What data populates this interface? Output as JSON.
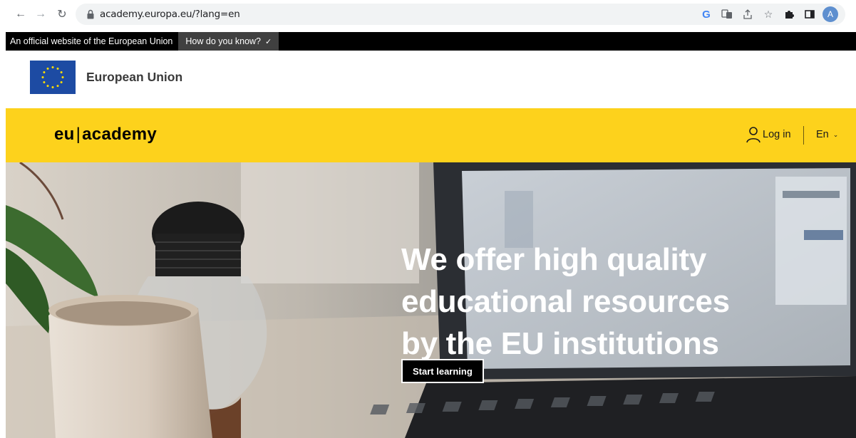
{
  "browser": {
    "url": "academy.europa.eu/?lang=en",
    "avatar_letter": "A",
    "extension_icons": [
      "google-icon",
      "translate-icon",
      "share-icon",
      "star-icon",
      "puzzle-icon",
      "split-view-icon"
    ]
  },
  "official_banner": {
    "text": "An official website of the European Union",
    "how_label": "How do you know?"
  },
  "eu_header": {
    "name": "European Union"
  },
  "site_header": {
    "logo_left": "eu",
    "logo_sep": "|",
    "logo_right": "academy",
    "login_label": "Log in",
    "language": "En",
    "accent_color": "#fdd21c"
  },
  "hero": {
    "title": "We offer high quality educational resources by the EU institutions",
    "cta_label": "Start learning"
  }
}
